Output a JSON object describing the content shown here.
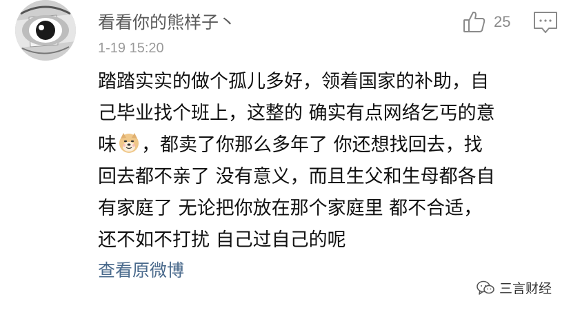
{
  "comment": {
    "username": "看看你的熊样子丶",
    "timestamp": "1-19 15:20",
    "like_count": "25",
    "lines": [
      "踏踏实实的做个孤儿多好，领着国家的补助，自",
      "己毕业找个班上，这整的 确实有点网络乞丐的意",
      "味",
      "，都卖了你那么多年了 你还想找回去，找",
      "回去都不亲了 没有意义，而且生父和生母都各自",
      "有家庭了 无论把你放在那个家庭里 都不合适，",
      "还不如不打扰 自己过自己的呢"
    ],
    "view_original": "查看原微博"
  },
  "icons": {
    "avatar": "avatar-image",
    "like": "thumbs-up-icon",
    "reply": "comment-bubble-icon",
    "emoji": "doge-emoji-icon",
    "watermark": "wechat-icon"
  },
  "watermark": {
    "text": "三言财经"
  },
  "colors": {
    "username": "#5a5a5a",
    "timestamp": "#9a9a9a",
    "body_text": "#111111",
    "link": "#4a6a8c",
    "icon_gray": "#8a8a8a"
  }
}
